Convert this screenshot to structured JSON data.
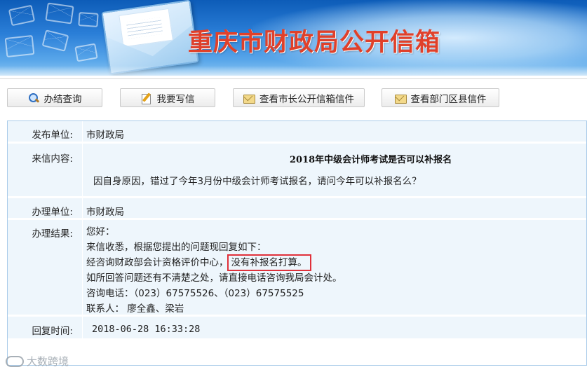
{
  "banner": {
    "title": "重庆市财政局公开信箱"
  },
  "toolbar": {
    "buttons": [
      {
        "label": "办结查询",
        "icon": "search-icon"
      },
      {
        "label": "我要写信",
        "icon": "write-icon"
      },
      {
        "label": "查看市长公开信箱信件",
        "icon": "mail-icon"
      },
      {
        "label": "查看部门区县信件",
        "icon": "mail-icon"
      }
    ]
  },
  "letter": {
    "publisher_label": "发布单位:",
    "publisher_value": "市财政局",
    "content_label": "来信内容:",
    "subject": "2018年中级会计师考试是否可以补报名",
    "body": "因自身原因，错过了今年3月份中级会计师考试报名，请问今年可以补报名么？",
    "handler_label": "办理单位:",
    "handler_value": "市财政局",
    "result_label": "办理结果:",
    "result_lines": [
      "您好：",
      "来信收悉，根据您提出的问题现回复如下：",
      "经咨询财政部会计资格评价中心，",
      "没有补报名打算。",
      "如所回答问题还有不清楚之处，请直接电话咨询我局会计处。",
      "咨询电话：（023）67575526、（023）67575525",
      "联系人： 廖全鑫、梁岩"
    ],
    "reply_time_label": "回复时间:",
    "reply_time_value": "2018-06-28 16:33:28"
  },
  "watermark": {
    "text": "大数跨境"
  },
  "colors": {
    "banner_top": "#0d5cb8",
    "title_red": "#e0402a",
    "row_bg": "#eef6fc",
    "highlight_border": "#e0303a"
  }
}
